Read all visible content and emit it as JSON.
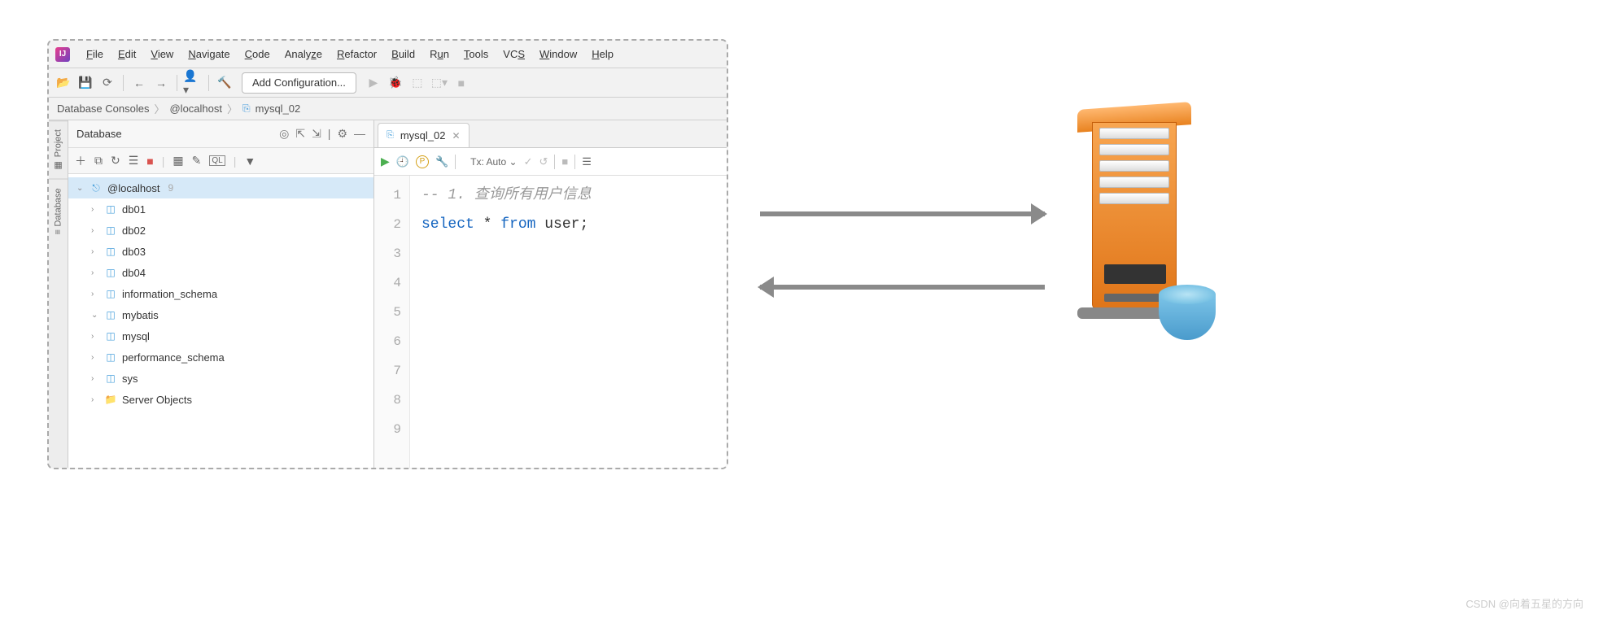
{
  "menu": [
    "File",
    "Edit",
    "View",
    "Navigate",
    "Code",
    "Analyze",
    "Refactor",
    "Build",
    "Run",
    "Tools",
    "VCS",
    "Window",
    "Help"
  ],
  "toolbar": {
    "config": "Add Configuration..."
  },
  "breadcrumb": {
    "a": "Database Consoles",
    "b": "@localhost",
    "c": "mysql_02"
  },
  "sideTabs": {
    "project": "Project",
    "database": "Database"
  },
  "dbPanel": {
    "title": "Database",
    "root": "@localhost",
    "rootCount": "9",
    "items": [
      {
        "label": "db01",
        "icon": "db"
      },
      {
        "label": "db02",
        "icon": "db"
      },
      {
        "label": "db03",
        "icon": "db"
      },
      {
        "label": "db04",
        "icon": "db"
      },
      {
        "label": "information_schema",
        "icon": "db"
      },
      {
        "label": "mybatis",
        "icon": "db",
        "open": true
      },
      {
        "label": "mysql",
        "icon": "db"
      },
      {
        "label": "performance_schema",
        "icon": "db"
      },
      {
        "label": "sys",
        "icon": "db"
      },
      {
        "label": "Server Objects",
        "icon": "folder"
      }
    ]
  },
  "editor": {
    "tab": "mysql_02",
    "tx": "Tx: Auto",
    "lines": [
      "1",
      "2",
      "3",
      "4",
      "5",
      "6",
      "7",
      "8",
      "9"
    ],
    "code": {
      "comment": "-- 1. 查询所有用户信息",
      "sql_kw1": "select",
      "sql_star": " * ",
      "sql_kw2": "from",
      "sql_tbl": " user;"
    }
  },
  "watermark": "CSDN @向着五星的方向"
}
